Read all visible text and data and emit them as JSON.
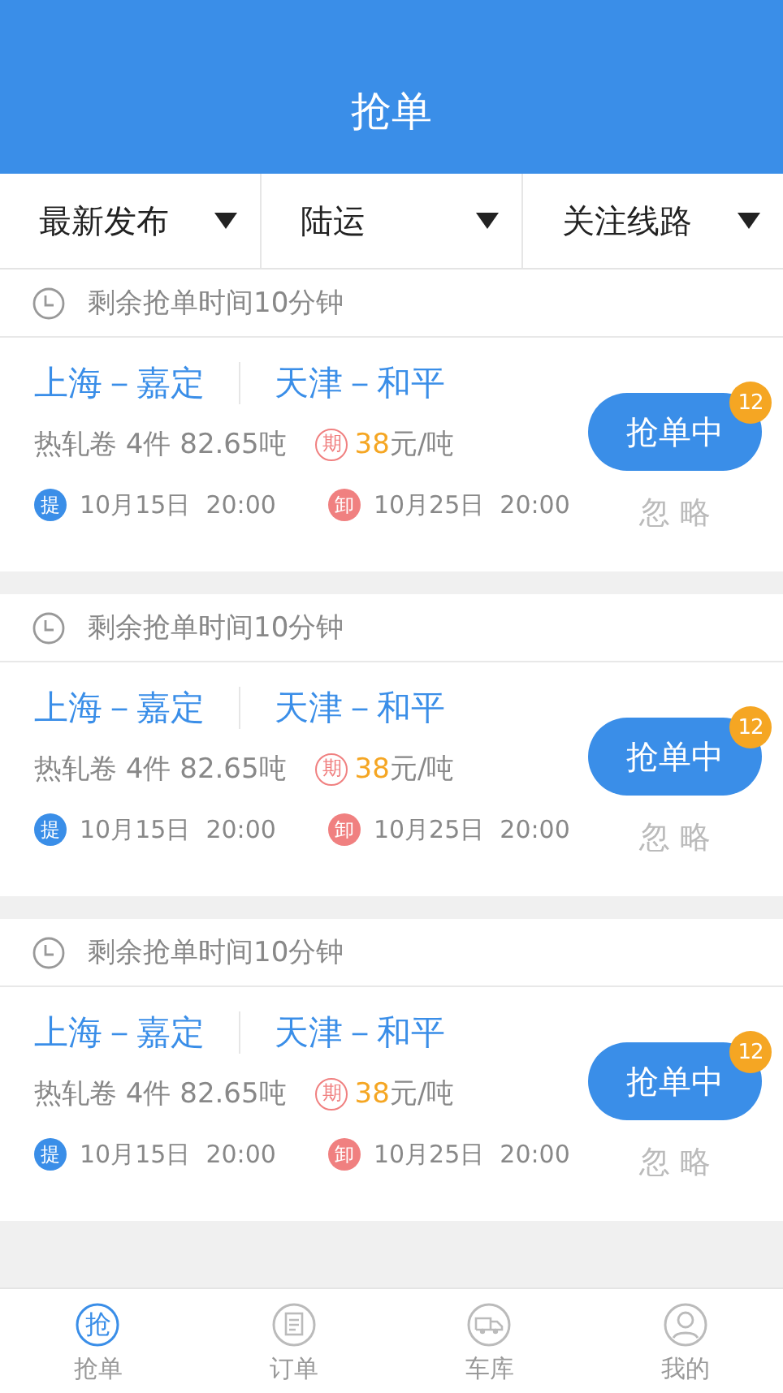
{
  "header": {
    "title": "抢单"
  },
  "filters": [
    {
      "label": "最新发布"
    },
    {
      "label": "陆运"
    },
    {
      "label": "关注线路"
    }
  ],
  "orders": [
    {
      "timer": "剩余抢单时间10分钟",
      "from": "上海－嘉定",
      "to": "天津－和平",
      "cargo": "热轧卷 4件 82.65吨",
      "price_tag": "期",
      "price": "38",
      "price_unit": "元/吨",
      "pickup_tag": "提",
      "pickup_time": "10月15日  20:00",
      "unload_tag": "卸",
      "unload_time": "10月25日  20:00",
      "action": "抢单中",
      "count": "12",
      "ignore": "忽 略"
    },
    {
      "timer": "剩余抢单时间10分钟",
      "from": "上海－嘉定",
      "to": "天津－和平",
      "cargo": "热轧卷 4件 82.65吨",
      "price_tag": "期",
      "price": "38",
      "price_unit": "元/吨",
      "pickup_tag": "提",
      "pickup_time": "10月15日  20:00",
      "unload_tag": "卸",
      "unload_time": "10月25日  20:00",
      "action": "抢单中",
      "count": "12",
      "ignore": "忽 略"
    },
    {
      "timer": "剩余抢单时间10分钟",
      "from": "上海－嘉定",
      "to": "天津－和平",
      "cargo": "热轧卷 4件 82.65吨",
      "price_tag": "期",
      "price": "38",
      "price_unit": "元/吨",
      "pickup_tag": "提",
      "pickup_time": "10月15日  20:00",
      "unload_tag": "卸",
      "unload_time": "10月25日  20:00",
      "action": "抢单中",
      "count": "12",
      "ignore": "忽 略"
    }
  ],
  "tabbar": [
    {
      "kind": "grab",
      "icon_text": "抢",
      "label": "抢单",
      "selected": true
    },
    {
      "kind": "orders",
      "label": "订单",
      "selected": false
    },
    {
      "kind": "garage",
      "label": "车库",
      "selected": false
    },
    {
      "kind": "profile",
      "label": "我的",
      "selected": false
    }
  ]
}
